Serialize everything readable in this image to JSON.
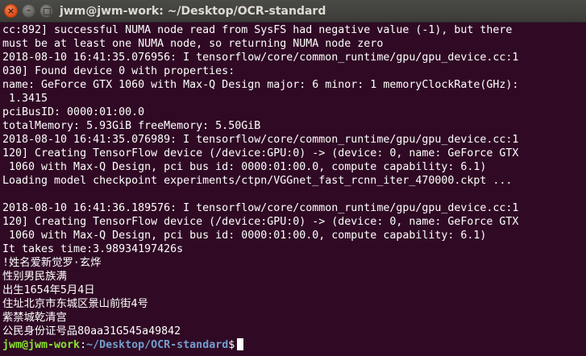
{
  "window": {
    "title": "jwm@jwm-work: ~/Desktop/OCR-standard",
    "close_glyph": "×",
    "minimize_glyph": "–"
  },
  "terminal": {
    "lines": [
      "cc:892] successful NUMA node read from SysFS had negative value (-1), but there",
      "must be at least one NUMA node, so returning NUMA node zero",
      "2018-08-10 16:41:35.076956: I tensorflow/core/common_runtime/gpu/gpu_device.cc:1",
      "030] Found device 0 with properties:",
      "name: GeForce GTX 1060 with Max-Q Design major: 6 minor: 1 memoryClockRate(GHz):",
      " 1.3415",
      "pciBusID: 0000:01:00.0",
      "totalMemory: 5.93GiB freeMemory: 5.50GiB",
      "2018-08-10 16:41:35.076989: I tensorflow/core/common_runtime/gpu/gpu_device.cc:1",
      "120] Creating TensorFlow device (/device:GPU:0) -> (device: 0, name: GeForce GTX",
      " 1060 with Max-Q Design, pci bus id: 0000:01:00.0, compute capability: 6.1)",
      "Loading model checkpoint experiments/ctpn/VGGnet_fast_rcnn_iter_470000.ckpt ...",
      "",
      "2018-08-10 16:41:36.189576: I tensorflow/core/common_runtime/gpu/gpu_device.cc:1",
      "120] Creating TensorFlow device (/device:GPU:0) -> (device: 0, name: GeForce GTX",
      " 1060 with Max-Q Design, pci bus id: 0000:01:00.0, compute capability: 6.1)",
      "It takes time:3.98934197426s",
      "!姓名爱新觉罗·玄烨",
      "性别男民族满",
      "出生1654年5月4日",
      "住址北京市东城区景山前街4号",
      "紫禁城乾清宫",
      "公民身份证号品80aa31G545a49842"
    ],
    "prompt": {
      "user_host": "jwm@jwm-work",
      "separator": ":",
      "path": "~/Desktop/OCR-standard",
      "symbol": "$"
    }
  },
  "colors": {
    "background": "#300a24",
    "text": "#ffffff",
    "prompt_user": "#8ae234",
    "prompt_path": "#729fcf"
  }
}
